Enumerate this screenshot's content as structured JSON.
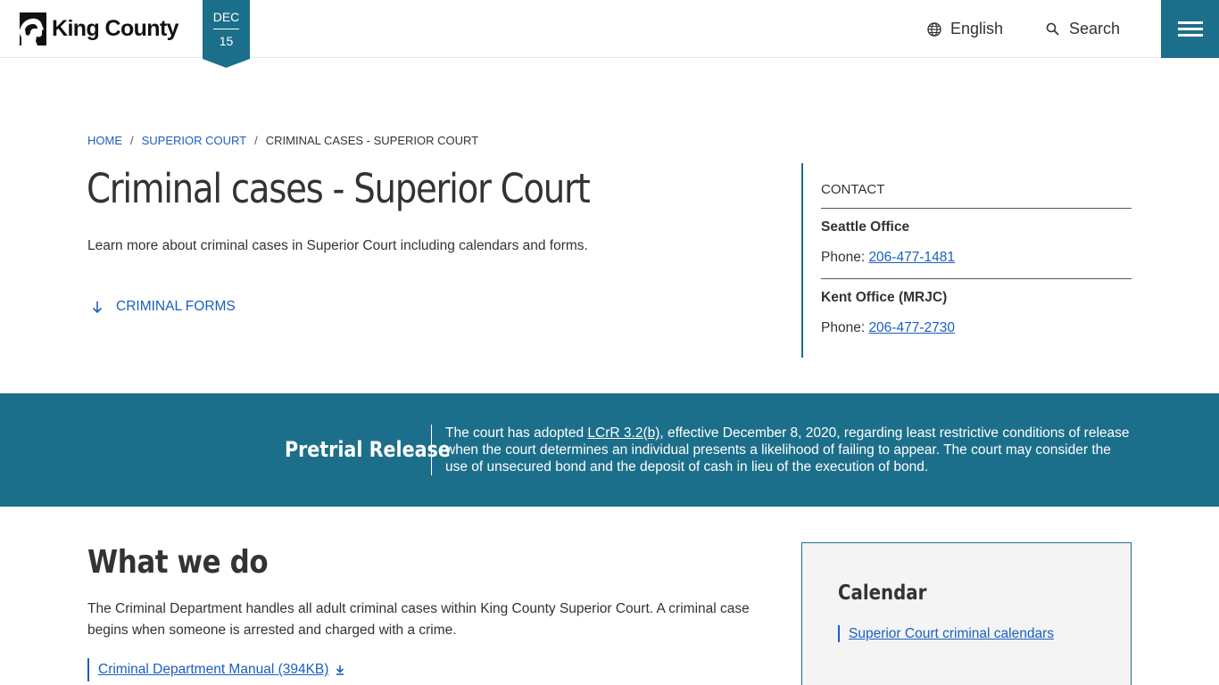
{
  "header": {
    "logo_text": "King County",
    "date": {
      "month": "DEC",
      "day": "15"
    },
    "language_label": "English",
    "search_label": "Search"
  },
  "breadcrumb": {
    "items": [
      "HOME",
      "SUPERIOR COURT",
      "CRIMINAL CASES - SUPERIOR COURT"
    ],
    "separator": "/"
  },
  "page": {
    "title": "Criminal cases - Superior Court",
    "lead": "Learn more about criminal cases in Superior Court including calendars and forms.",
    "jump_link": "CRIMINAL FORMS"
  },
  "contact": {
    "heading": "CONTACT",
    "offices": [
      {
        "name": "Seattle Office",
        "phone_label": "Phone: ",
        "phone": "206-477-1481"
      },
      {
        "name": "Kent Office (MRJC)",
        "phone_label": "Phone: ",
        "phone": "206-477-2730"
      }
    ]
  },
  "banner": {
    "title": "Pretrial Release",
    "text_before": "The court has adopted ",
    "link": "LCrR 3.2(b)",
    "text_after": ", effective December 8, 2020, regarding least restrictive conditions of release when the court determines an individual presents a likelihood of failing to appear. The court may consider the use of unsecured bond and the deposit of cash in lieu of the execution of bond."
  },
  "what_we_do": {
    "title": "What we do",
    "body": "The Criminal Department handles all adult criminal cases within King County Superior Court. A criminal case begins when someone is arrested and charged with a crime.",
    "doc_link": "Criminal Department Manual (394KB)"
  },
  "calendar": {
    "title": "Calendar",
    "link": "Superior Court criminal calendars"
  },
  "colors": {
    "brand_teal": "#1c6f8a",
    "link_blue": "#1a5fbf"
  }
}
